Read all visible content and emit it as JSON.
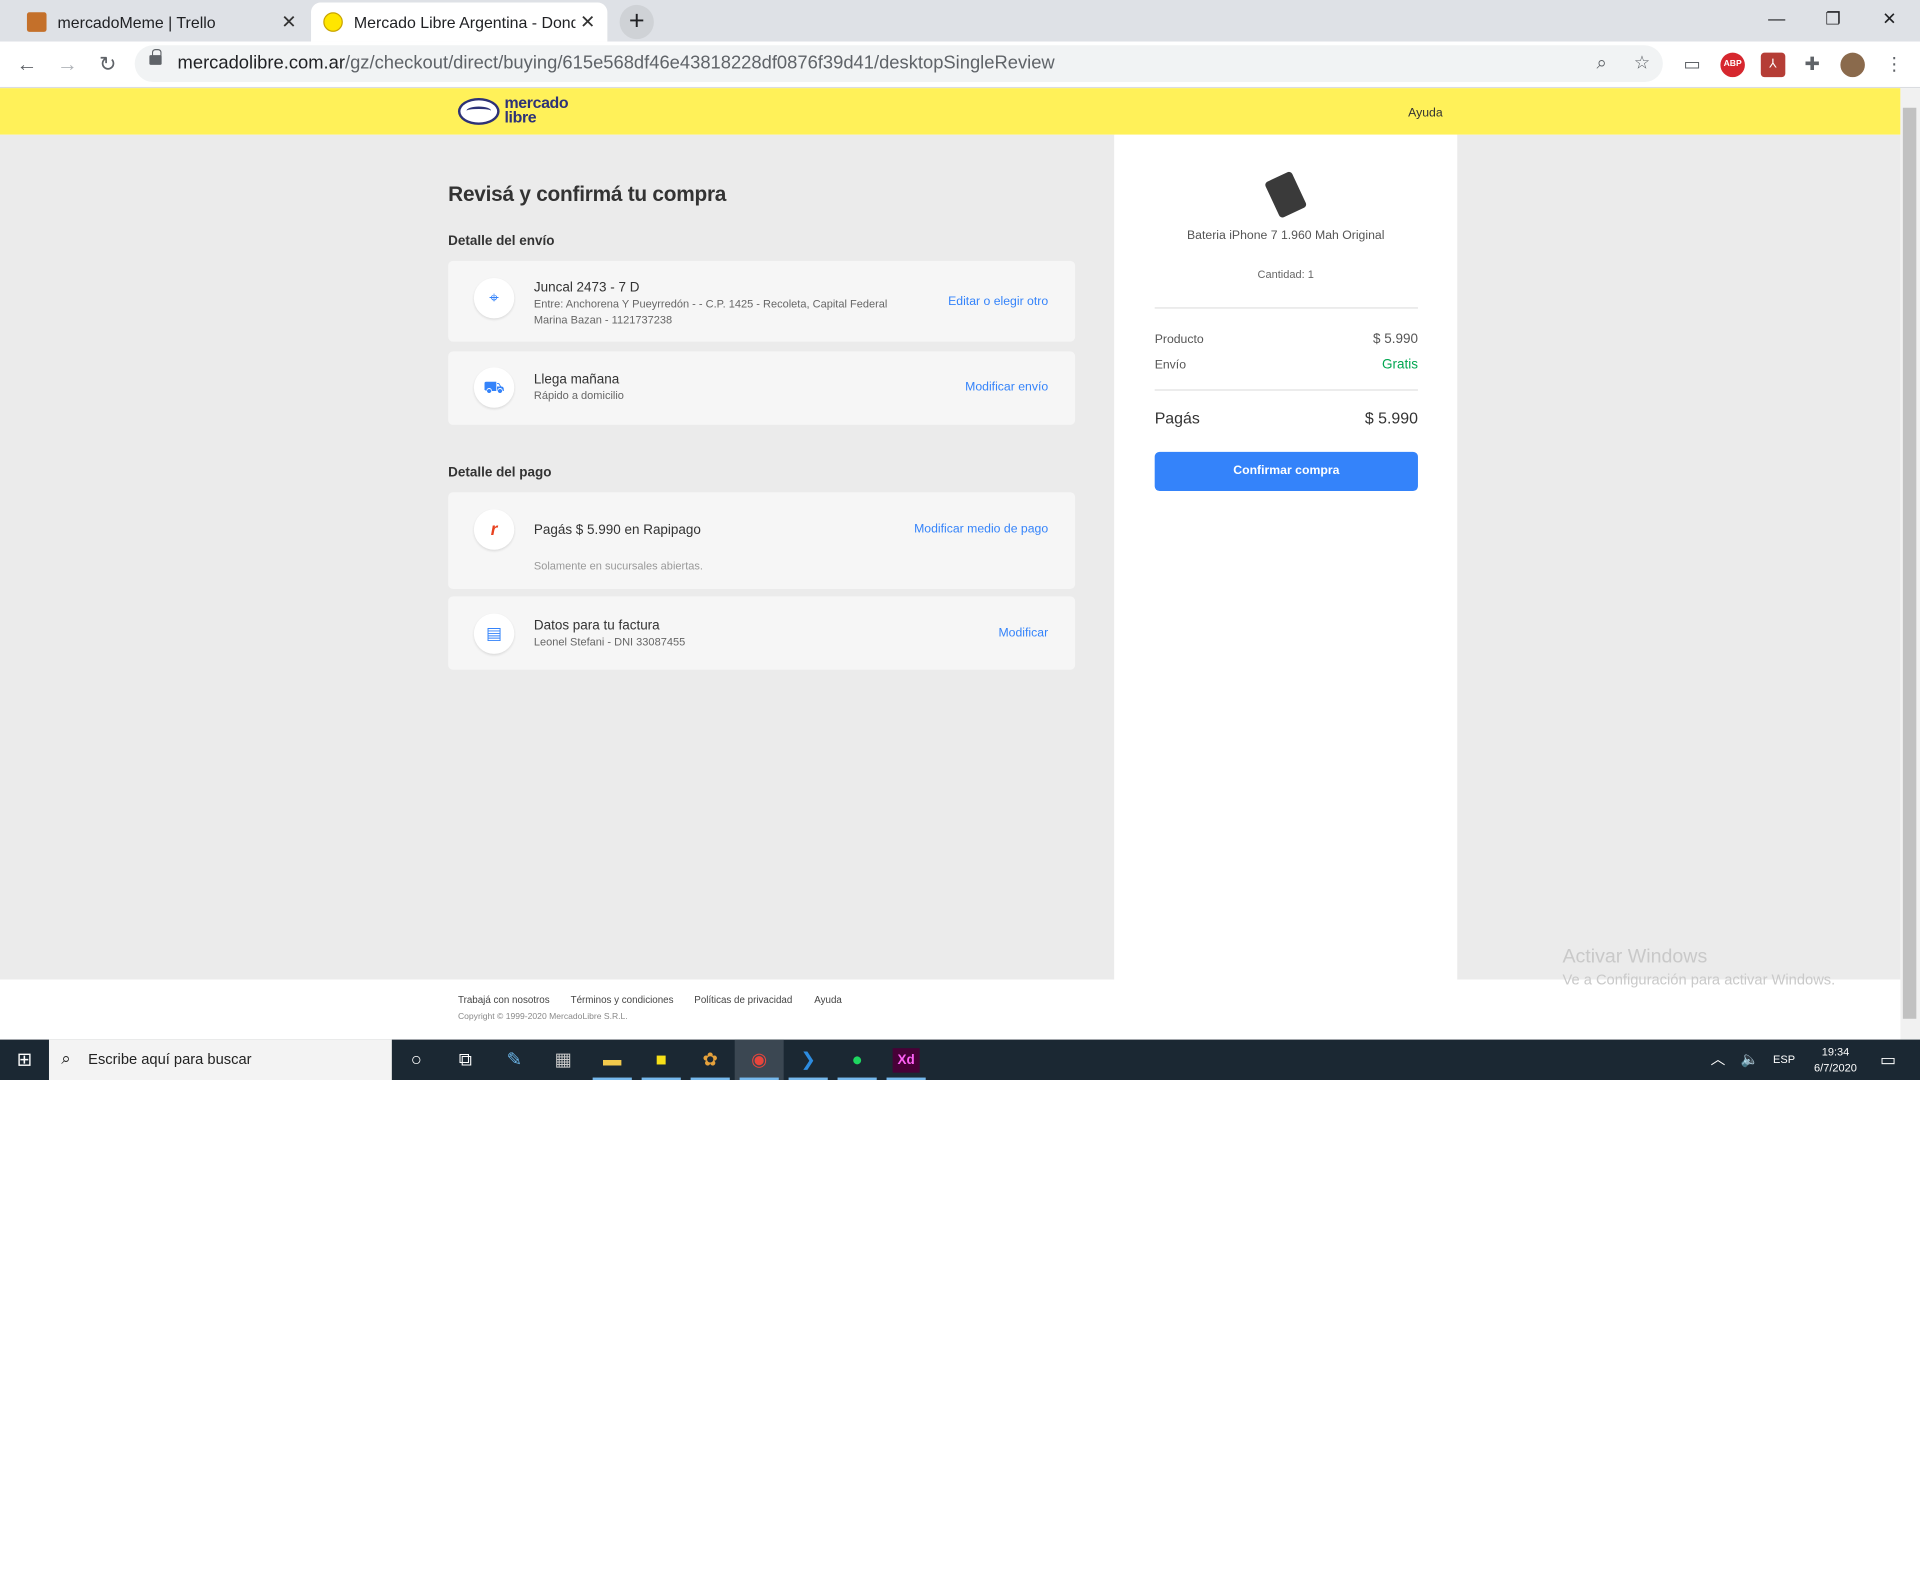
{
  "browser": {
    "tabs": [
      {
        "title": "mercadoMeme | Trello",
        "favicon": "trello-icon"
      },
      {
        "title": "Mercado Libre Argentina - Dond",
        "favicon": "mercadolibre-icon"
      }
    ],
    "url_host": "mercadolibre.com.ar",
    "url_path": "/gz/checkout/direct/buying/615e568df46e43818228df0876f39d41/desktopSingleReview",
    "abp_label": "ABP"
  },
  "header": {
    "logo_line1": "mercado",
    "logo_line2": "libre",
    "help": "Ayuda",
    "brand_color": "#fff159"
  },
  "main": {
    "title": "Revisá y confirmá tu compra",
    "shipping_section": "Detalle del envío",
    "address": {
      "line1": "Juncal 2473 - 7 D",
      "line2": "Entre: Anchorena Y Pueyrredón - - C.P. 1425 - Recoleta, Capital Federal",
      "line3": "Marina Bazan - 1121737238",
      "link": "Editar o elegir otro"
    },
    "delivery": {
      "line1": "Llega mañana",
      "line2": "Rápido a domicilio",
      "link": "Modificar envío"
    },
    "payment_section": "Detalle del pago",
    "payment": {
      "line1": "Pagás $ 5.990 en Rapipago",
      "line2": "Solamente en sucursales abiertas.",
      "link": "Modificar medio de pago"
    },
    "invoice": {
      "line1": "Datos para tu factura",
      "line2": "Leonel Stefani - DNI 33087455",
      "link": "Modificar"
    }
  },
  "summary": {
    "product_name": "Bateria iPhone 7 1.960 Mah Original",
    "quantity": "Cantidad: 1",
    "product_label": "Producto",
    "product_value": "$ 5.990",
    "shipping_label": "Envío",
    "shipping_value": "Gratis",
    "total_label": "Pagás",
    "total_value": "$ 5.990",
    "confirm_button": "Confirmar compra",
    "accent_color": "#3483fa",
    "free_color": "#00a650"
  },
  "footer": {
    "links": [
      "Trabajá con nosotros",
      "Términos y condiciones",
      "Políticas de privacidad",
      "Ayuda"
    ],
    "copyright": "Copyright © 1999-2020 MercadoLibre S.R.L."
  },
  "watermark": {
    "line1": "Activar Windows",
    "line2": "Ve a Configuración para activar Windows."
  },
  "taskbar": {
    "search_placeholder": "Escribe aquí para buscar",
    "language": "ESP",
    "time": "19:34",
    "date": "6/7/2020",
    "xd_label": "Xd"
  }
}
